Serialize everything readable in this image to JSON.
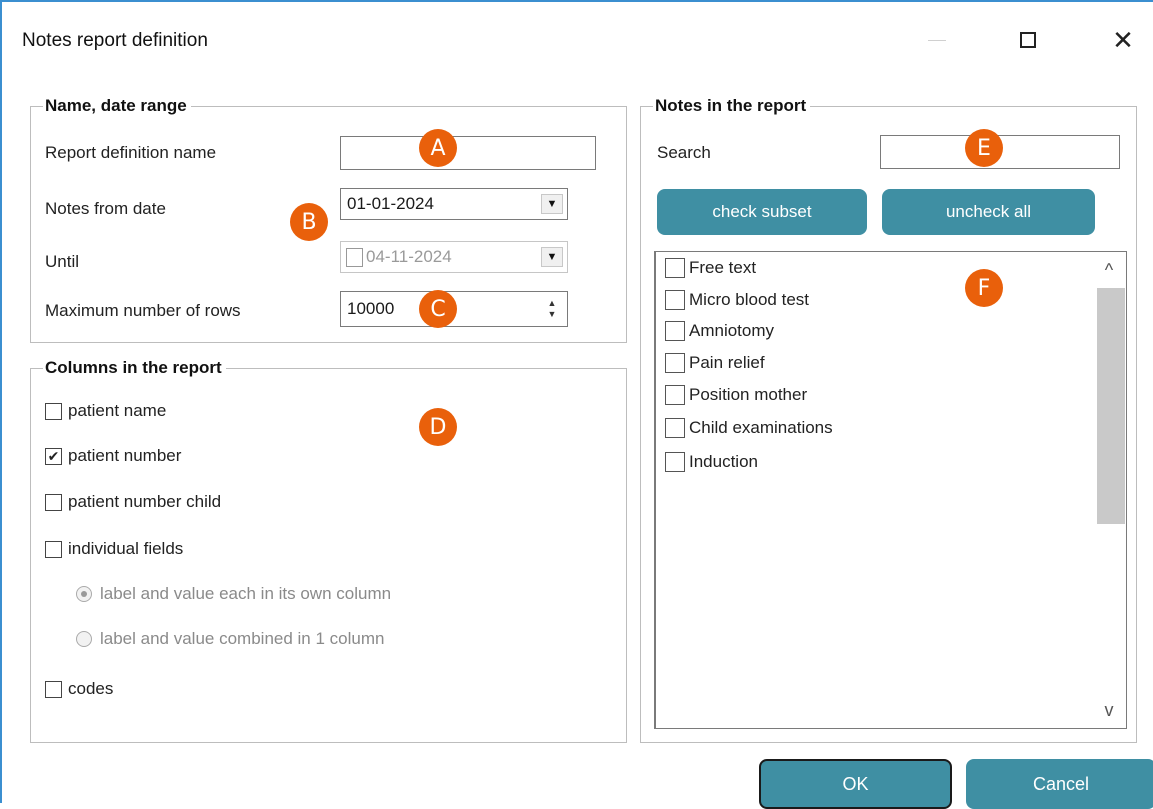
{
  "window": {
    "title": "Notes report definition",
    "controls": {
      "minimize": "—",
      "maximize": "",
      "close": "✕"
    }
  },
  "name_date": {
    "legend": "Name, date range",
    "report_name_label": "Report definition name",
    "report_name_value": "",
    "from_label": "Notes from date",
    "from_value": "01-01-2024",
    "until_label": "Until",
    "until_value": "04-11-2024",
    "until_checked": false,
    "max_rows_label": "Maximum number of rows",
    "max_rows_value": "10000"
  },
  "columns": {
    "legend": "Columns in the report",
    "items": [
      {
        "label": "patient name",
        "checked": false
      },
      {
        "label": "patient number",
        "checked": true
      },
      {
        "label": "patient number child",
        "checked": false
      },
      {
        "label": "individual fields",
        "checked": false
      }
    ],
    "radios": [
      {
        "label": "label and value each in its own column",
        "selected": true
      },
      {
        "label": "label and value combined in 1 column",
        "selected": false
      }
    ],
    "codes": {
      "label": "codes",
      "checked": false
    }
  },
  "notes": {
    "legend": "Notes in the report",
    "search_label": "Search",
    "search_value": "",
    "check_subset_label": "check subset",
    "uncheck_all_label": "uncheck all",
    "items": [
      {
        "label": "Free text",
        "checked": false
      },
      {
        "label": "Micro blood test",
        "checked": false
      },
      {
        "label": "Amniotomy",
        "checked": false
      },
      {
        "label": "Pain relief",
        "checked": false
      },
      {
        "label": "Position mother",
        "checked": false
      },
      {
        "label": "Child examinations",
        "checked": false
      },
      {
        "label": "Induction",
        "checked": false
      }
    ],
    "scroll_up": "^",
    "scroll_down": "v"
  },
  "footer": {
    "ok_label": "OK",
    "cancel_label": "Cancel"
  },
  "markers": {
    "a": "A",
    "b": "B",
    "c": "C",
    "d": "D",
    "e": "E",
    "f": "F"
  },
  "colors": {
    "button": "#3f8fa3",
    "marker": "#e9600b",
    "window_border": "#3b8fd0"
  }
}
